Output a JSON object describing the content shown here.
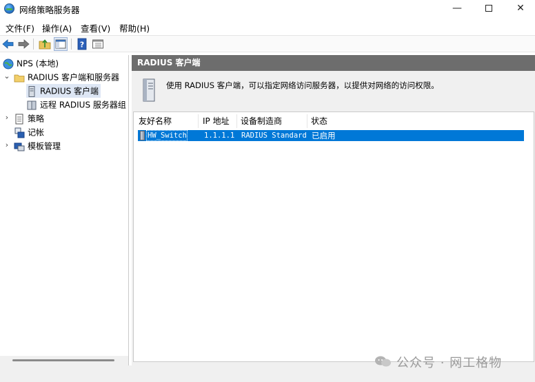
{
  "window": {
    "title": "网络策略服务器",
    "minimize": "—",
    "close": "✕"
  },
  "menu": {
    "items": [
      "文件(F)",
      "操作(A)",
      "查看(V)",
      "帮助(H)"
    ]
  },
  "toolbar": {
    "icons": [
      "back-arrow-icon",
      "forward-arrow-icon",
      "up-folder-icon",
      "show-hide-tree-icon",
      "help-icon",
      "console-view-icon"
    ]
  },
  "tree": {
    "root": "NPS (本地)",
    "radius_group": "RADIUS 客户端和服务器",
    "radius_clients": "RADIUS 客户端",
    "remote_groups": "远程 RADIUS 服务器组",
    "policies": "策略",
    "accounting": "记帐",
    "templates": "模板管理"
  },
  "main": {
    "header": "RADIUS 客户端",
    "description": "使用 RADIUS 客户端，可以指定网络访问服务器，以提供对网络的访问权限。",
    "columns": [
      "友好名称",
      "IP 地址",
      "设备制造商",
      "状态"
    ],
    "rows": [
      {
        "name": "HW_Switch",
        "ip": "1.1.1.1",
        "vendor": "RADIUS Standard",
        "status": "已启用"
      }
    ]
  },
  "watermark": "公众号 · 网工格物"
}
